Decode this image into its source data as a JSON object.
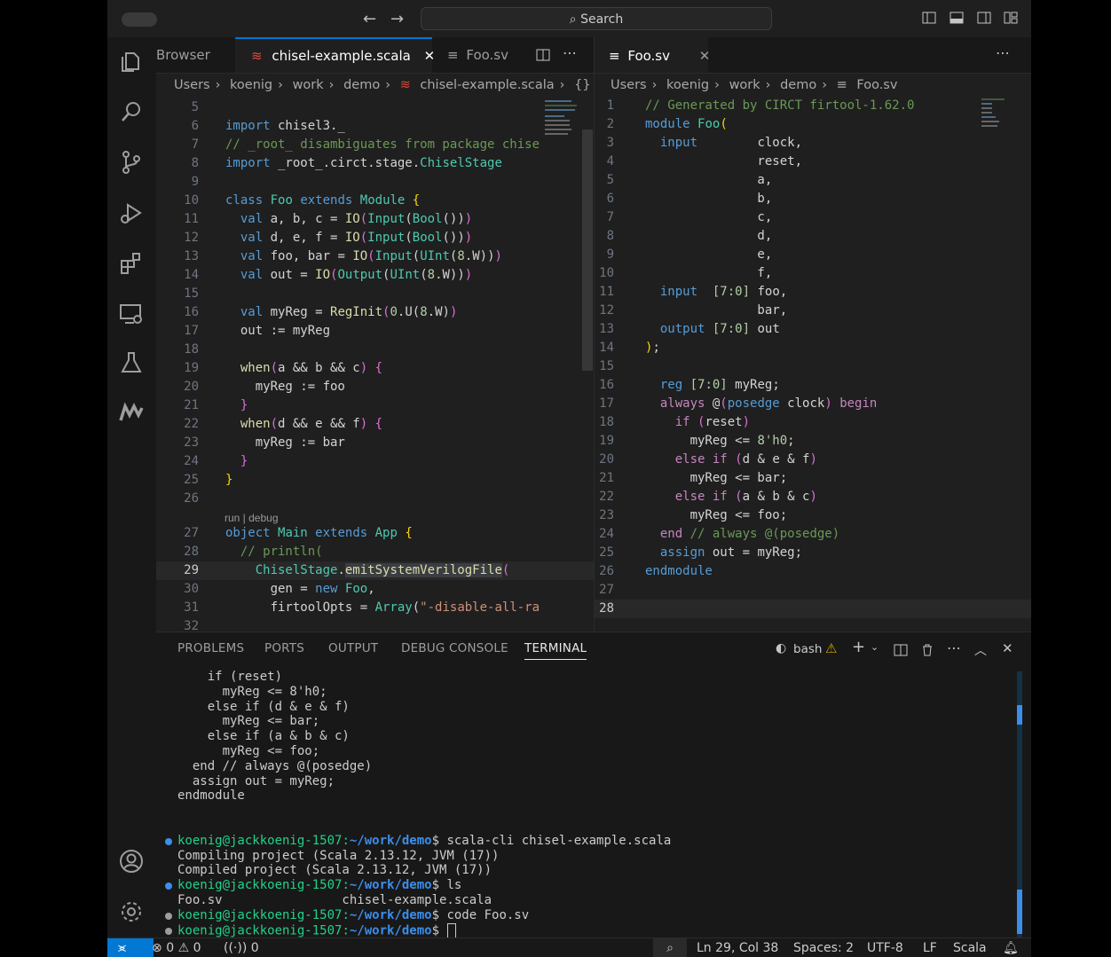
{
  "titlebar": {
    "search_placeholder": "Search"
  },
  "editor_left": {
    "tabs": [
      {
        "label": "Browser",
        "active": false
      },
      {
        "label": "chisel-example.scala",
        "active": true
      },
      {
        "label": "Foo.sv",
        "active": false
      }
    ],
    "breadcrumb": [
      "Users",
      "koenig",
      "work",
      "demo",
      "chisel-example.scala",
      "{} Ma"
    ],
    "codelens": "run | debug",
    "lines": [
      {
        "n": "5",
        "html": ""
      },
      {
        "n": "6",
        "html": "<span class=\"kw\">import</span> chisel3._"
      },
      {
        "n": "7",
        "html": "<span class=\"cm\">// _root_ disambiguates from package chise</span>"
      },
      {
        "n": "8",
        "html": "<span class=\"kw\">import</span> _root_.circt.stage.<span class=\"ty\">ChiselStage</span>"
      },
      {
        "n": "9",
        "html": ""
      },
      {
        "n": "10",
        "html": "<span class=\"kw\">class</span> <span class=\"ty\">Foo</span> <span class=\"kw\">extends</span> <span class=\"ty\">Module</span> <span class=\"br2\">{</span>"
      },
      {
        "n": "11",
        "html": "  <span class=\"kw\">val</span> a, b, c = <span class=\"fn\">IO</span><span class=\"br\">(</span><span class=\"ty\">Input</span>(<span class=\"ty\">Bool</span>())<span class=\"br\">)</span>"
      },
      {
        "n": "12",
        "html": "  <span class=\"kw\">val</span> d, e, f = <span class=\"fn\">IO</span><span class=\"br\">(</span><span class=\"ty\">Input</span>(<span class=\"ty\">Bool</span>())<span class=\"br\">)</span>"
      },
      {
        "n": "13",
        "html": "  <span class=\"kw\">val</span> foo, bar = <span class=\"fn\">IO</span><span class=\"br\">(</span><span class=\"ty\">Input</span>(<span class=\"ty\">UInt</span>(<span class=\"num\">8</span>.W))<span class=\"br\">)</span>"
      },
      {
        "n": "14",
        "html": "  <span class=\"kw\">val</span> out = <span class=\"fn\">IO</span><span class=\"br\">(</span><span class=\"ty\">Output</span>(<span class=\"ty\">UInt</span>(<span class=\"num\">8</span>.W))<span class=\"br\">)</span>"
      },
      {
        "n": "15",
        "html": ""
      },
      {
        "n": "16",
        "html": "  <span class=\"kw\">val</span> myReg = <span class=\"fn\">RegInit</span><span class=\"br\">(</span><span class=\"num\">0</span>.U(<span class=\"num\">8</span>.W)<span class=\"br\">)</span>"
      },
      {
        "n": "17",
        "html": "  out := myReg"
      },
      {
        "n": "18",
        "html": ""
      },
      {
        "n": "19",
        "html": "  <span class=\"fn\">when</span><span class=\"br\">(</span>a &amp;&amp; b &amp;&amp; c<span class=\"br\">)</span> <span class=\"br\">{</span>"
      },
      {
        "n": "20",
        "html": "    myReg := foo"
      },
      {
        "n": "21",
        "html": "  <span class=\"br\">}</span>"
      },
      {
        "n": "22",
        "html": "  <span class=\"fn\">when</span><span class=\"br\">(</span>d &amp;&amp; e &amp;&amp; f<span class=\"br\">)</span> <span class=\"br\">{</span>"
      },
      {
        "n": "23",
        "html": "    myReg := bar"
      },
      {
        "n": "24",
        "html": "  <span class=\"br\">}</span>"
      },
      {
        "n": "25",
        "html": "<span class=\"br2\">}</span>"
      },
      {
        "n": "26",
        "html": ""
      },
      {
        "n": "27",
        "html": "<span class=\"kw\">object</span> <span class=\"ty\">Main</span> <span class=\"kw\">extends</span> <span class=\"ty\">App</span> <span class=\"br2\">{</span>"
      },
      {
        "n": "28",
        "html": "  <span class=\"cm\">// println(</span>"
      },
      {
        "n": "29",
        "html": "    <span class=\"ty\">ChiselStage</span>.<span class=\"fn\" style=\"background:#3a3d41\">emitSystemVerilogFile</span><span class=\"br\">(</span>"
      },
      {
        "n": "30",
        "html": "      gen = <span class=\"kw\">new</span> <span class=\"ty\">Foo</span>,"
      },
      {
        "n": "31",
        "html": "      firtoolOpts = <span class=\"ty\">Array</span>(<span class=\"str\">\"-disable-all-ra</span>"
      },
      {
        "n": "32",
        "html": ""
      }
    ]
  },
  "editor_right": {
    "tabs": [
      {
        "label": "Foo.sv",
        "active": true
      }
    ],
    "breadcrumb": [
      "Users",
      "koenig",
      "work",
      "demo",
      "Foo.sv"
    ],
    "lines": [
      {
        "n": "1",
        "html": "<span class=\"cm\">// Generated by CIRCT firtool-1.62.0</span>"
      },
      {
        "n": "2",
        "html": "<span class=\"kw\">module</span> <span class=\"ty\">Foo</span><span class=\"br2\">(</span>"
      },
      {
        "n": "3",
        "html": "  <span class=\"kw\">input</span>        clock,"
      },
      {
        "n": "4",
        "html": "               reset,"
      },
      {
        "n": "5",
        "html": "               a,"
      },
      {
        "n": "6",
        "html": "               b,"
      },
      {
        "n": "7",
        "html": "               c,"
      },
      {
        "n": "8",
        "html": "               d,"
      },
      {
        "n": "9",
        "html": "               e,"
      },
      {
        "n": "10",
        "html": "               f,"
      },
      {
        "n": "11",
        "html": "  <span class=\"kw\">input</span>  <span class=\"num\">[7:0]</span> foo,"
      },
      {
        "n": "12",
        "html": "               bar,"
      },
      {
        "n": "13",
        "html": "  <span class=\"kw\">output</span> <span class=\"num\">[7:0]</span> out"
      },
      {
        "n": "14",
        "html": "<span class=\"br2\">)</span>;"
      },
      {
        "n": "15",
        "html": ""
      },
      {
        "n": "16",
        "html": "  <span class=\"kw\">reg</span> <span class=\"num\">[7:0]</span> myReg;"
      },
      {
        "n": "17",
        "html": "  <span class=\"pp\">always</span> @<span class=\"br\">(</span><span class=\"kw\">posedge</span> clock<span class=\"br\">)</span> <span class=\"pp\">begin</span>"
      },
      {
        "n": "18",
        "html": "    <span class=\"pp\">if</span> <span class=\"br\">(</span>reset<span class=\"br\">)</span>"
      },
      {
        "n": "19",
        "html": "      myReg &lt;= <span class=\"num\">8'h0</span>;"
      },
      {
        "n": "20",
        "html": "    <span class=\"pp\">else if</span> <span class=\"br\">(</span>d &amp; e &amp; f<span class=\"br\">)</span>"
      },
      {
        "n": "21",
        "html": "      myReg &lt;= bar;"
      },
      {
        "n": "22",
        "html": "    <span class=\"pp\">else if</span> <span class=\"br\">(</span>a &amp; b &amp; c<span class=\"br\">)</span>"
      },
      {
        "n": "23",
        "html": "      myReg &lt;= foo;"
      },
      {
        "n": "24",
        "html": "  <span class=\"pp\">end</span> <span class=\"cm\">// always @(posedge)</span>"
      },
      {
        "n": "25",
        "html": "  <span class=\"kw\">assign</span> out = myReg;"
      },
      {
        "n": "26",
        "html": "<span class=\"kw\">endmodule</span>"
      },
      {
        "n": "27",
        "html": ""
      },
      {
        "n": "28",
        "html": ""
      }
    ]
  },
  "panel": {
    "tabs": [
      "PROBLEMS",
      "PORTS",
      "OUTPUT",
      "DEBUG CONSOLE",
      "TERMINAL"
    ],
    "active_tab": "TERMINAL",
    "shell": "bash"
  },
  "terminal": {
    "lines": [
      {
        "text": "    if (reset)"
      },
      {
        "text": "      myReg <= 8'h0;"
      },
      {
        "text": "    else if (d & e & f)"
      },
      {
        "text": "      myReg <= bar;"
      },
      {
        "text": "    else if (a & b & c)"
      },
      {
        "text": "      myReg <= foo;"
      },
      {
        "text": "  end // always @(posedge)"
      },
      {
        "text": "  assign out = myReg;"
      },
      {
        "text": "endmodule"
      },
      {
        "text": ""
      },
      {
        "text": ""
      },
      {
        "prompt": true,
        "dot": "#3b8eea",
        "user": "koenig",
        "host": "@jackkoenig-1507:",
        "path": "~/work/demo",
        "cmd": "$ scala-cli chisel-example.scala"
      },
      {
        "text": "Compiling project (Scala 2.13.12, JVM (17))"
      },
      {
        "text": "Compiled project (Scala 2.13.12, JVM (17))"
      },
      {
        "prompt": true,
        "dot": "#3b8eea",
        "user": "koenig",
        "host": "@jackkoenig-1507:",
        "path": "~/work/demo",
        "cmd": "$ ls"
      },
      {
        "text": "Foo.sv                chisel-example.scala"
      },
      {
        "prompt": true,
        "dot": "#9d9d9d",
        "user": "koenig",
        "host": "@jackkoenig-1507:",
        "path": "~/work/demo",
        "cmd": "$ code Foo.sv"
      },
      {
        "prompt": true,
        "dot": "#9d9d9d",
        "user": "koenig",
        "host": "@jackkoenig-1507:",
        "path": "~/work/demo",
        "cmd": "$ ",
        "cursor": true
      }
    ]
  },
  "statusbar": {
    "errors": "0",
    "warnings": "0",
    "ports": "0",
    "position": "Ln 29, Col 38",
    "spaces": "Spaces: 2",
    "encoding": "UTF-8",
    "eol": "LF",
    "language": "Scala"
  }
}
